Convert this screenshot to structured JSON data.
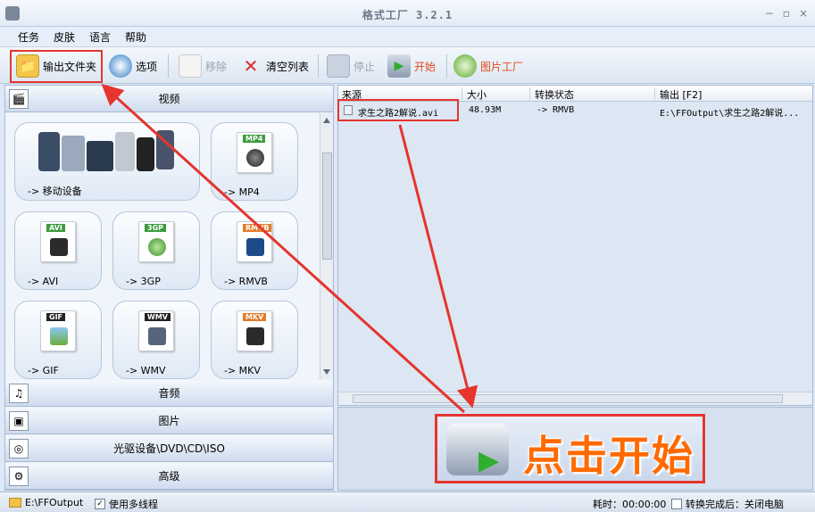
{
  "window": {
    "title": "格式工厂 3.2.1",
    "controls": [
      "−",
      "▫",
      "×"
    ]
  },
  "menu": [
    "任务",
    "皮肤",
    "语言",
    "帮助"
  ],
  "toolbar": {
    "output_folder": "输出文件夹",
    "options": "选项",
    "remove": "移除",
    "clear_list": "清空列表",
    "stop": "停止",
    "start": "开始",
    "image_factory": "图片工厂"
  },
  "categories": {
    "video": "视频",
    "audio": "音频",
    "image": "图片",
    "disc": "光驱设备\\DVD\\CD\\ISO",
    "advanced": "高级"
  },
  "video_tiles": [
    {
      "label": "-> 移动设备"
    },
    {
      "label": "-> MP4",
      "tag": "MP4"
    },
    {
      "label": "-> AVI",
      "tag": "AVI"
    },
    {
      "label": "-> 3GP",
      "tag": "3GP"
    },
    {
      "label": "-> RMVB",
      "tag": "RMVB"
    },
    {
      "label": "-> GIF",
      "tag": "GIF"
    },
    {
      "label": "-> WMV",
      "tag": "WMV"
    },
    {
      "label": "-> MKV",
      "tag": "MKV"
    }
  ],
  "list": {
    "columns": [
      "来源",
      "大小",
      "转换状态",
      "输出 [F2]"
    ],
    "rows": [
      {
        "source": "求生之路2解说.avi",
        "size": "48.93M",
        "status": "-> RMVB",
        "output": "E:\\FFOutput\\求生之路2解说..."
      }
    ]
  },
  "callout": {
    "text": "点击开始"
  },
  "status": {
    "output_path": "E:\\FFOutput",
    "multithread_label": "使用多线程",
    "multithread_checked": "✓",
    "elapsed": "耗时：00:00:00",
    "after_label": "转换完成后：关闭电脑"
  },
  "colors": {
    "annotation": "#e5352e",
    "callout_text": "#ff6a00"
  }
}
